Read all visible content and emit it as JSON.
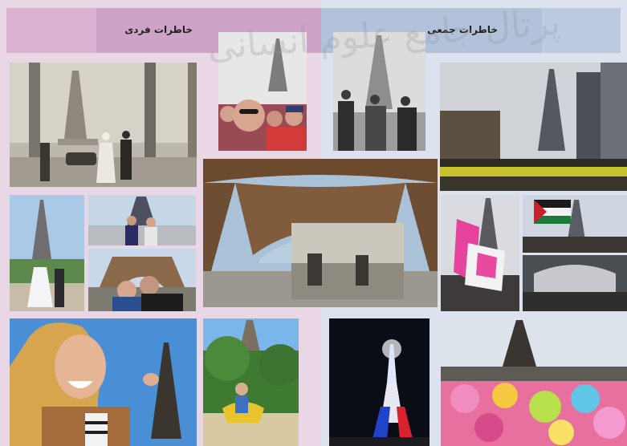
{
  "headings": {
    "individual_memories": "خاطرات فردی",
    "collective_memories": "خاطرات جمعی"
  },
  "watermark": "پرتال جامع علوم انسانی",
  "colors": {
    "left_panel": "#e9d7e6",
    "left_band": "#cfa2c7",
    "right_panel": "#dde3ee",
    "right_band": "#b1c2da"
  },
  "photos": [
    {
      "id": "wedding-bw",
      "subject": "black and white wedding couple at Eiffel Tower"
    },
    {
      "id": "family-selfie",
      "subject": "family selfie in front of Eiffel Tower"
    },
    {
      "id": "historic-officers",
      "subject": "historic officers in front of Eiffel Tower"
    },
    {
      "id": "protest-street",
      "subject": "crowd protest on avenue with Eiffel Tower"
    },
    {
      "id": "tower-base-old-photo",
      "subject": "old photograph held under Eiffel Tower arch"
    },
    {
      "id": "couple-wedding-color",
      "subject": "wedding couple near Eiffel Tower"
    },
    {
      "id": "couple-trocadero",
      "subject": "couple at Trocadero"
    },
    {
      "id": "couple-hug",
      "subject": "couple hugging under Eiffel Tower"
    },
    {
      "id": "pink-flags-protest",
      "subject": "pink flags at rally near Eiffel Tower"
    },
    {
      "id": "palestine-flag",
      "subject": "Palestinian flag protest"
    },
    {
      "id": "crowd-under-arch",
      "subject": "crowd under Eiffel Tower arch"
    },
    {
      "id": "laughing-girl",
      "subject": "laughing girl pinching Eiffel Tower"
    },
    {
      "id": "child-playground",
      "subject": "child on playground rocker in front of Eiffel Tower"
    },
    {
      "id": "tower-tricolor-night",
      "subject": "Eiffel Tower lit in tricolor at night"
    },
    {
      "id": "colour-run-crowd",
      "subject": "colourful festival crowd with Eiffel Tower"
    }
  ]
}
